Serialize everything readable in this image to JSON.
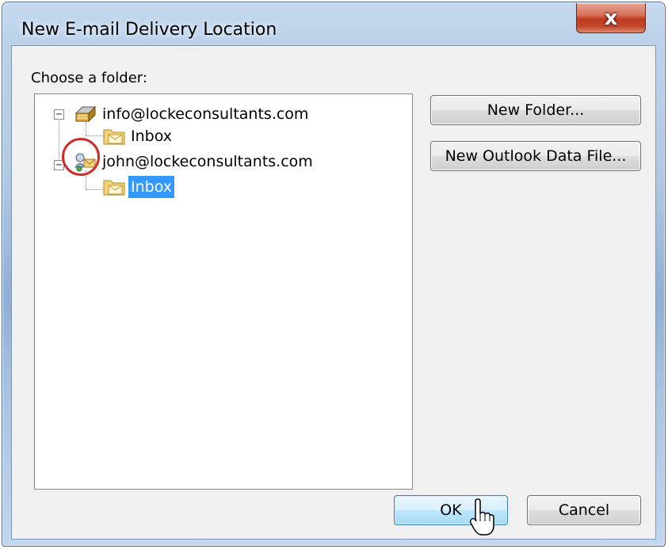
{
  "window": {
    "title": "New E-mail Delivery Location",
    "close_glyph": "x"
  },
  "dialog": {
    "choose_label": "Choose a folder:"
  },
  "tree": {
    "nodes": [
      {
        "label": "info@lockeconsultants.com",
        "icon": "pst-file-icon",
        "expanded": true,
        "level": 0
      },
      {
        "label": "Inbox",
        "icon": "inbox-folder-icon",
        "level": 1
      },
      {
        "label": "john@lockeconsultants.com",
        "icon": "exchange-mailbox-icon",
        "expanded": true,
        "level": 0
      },
      {
        "label": "Inbox",
        "icon": "inbox-folder-icon",
        "level": 1,
        "selected": true
      }
    ],
    "expander_glyph": "−"
  },
  "buttons": {
    "new_folder": "New Folder...",
    "new_data_file": "New Outlook Data File...",
    "ok": "OK",
    "cancel": "Cancel"
  },
  "colors": {
    "selection": "#3399ff",
    "annotation": "#d12a2a",
    "close_button": "#c0391f"
  }
}
